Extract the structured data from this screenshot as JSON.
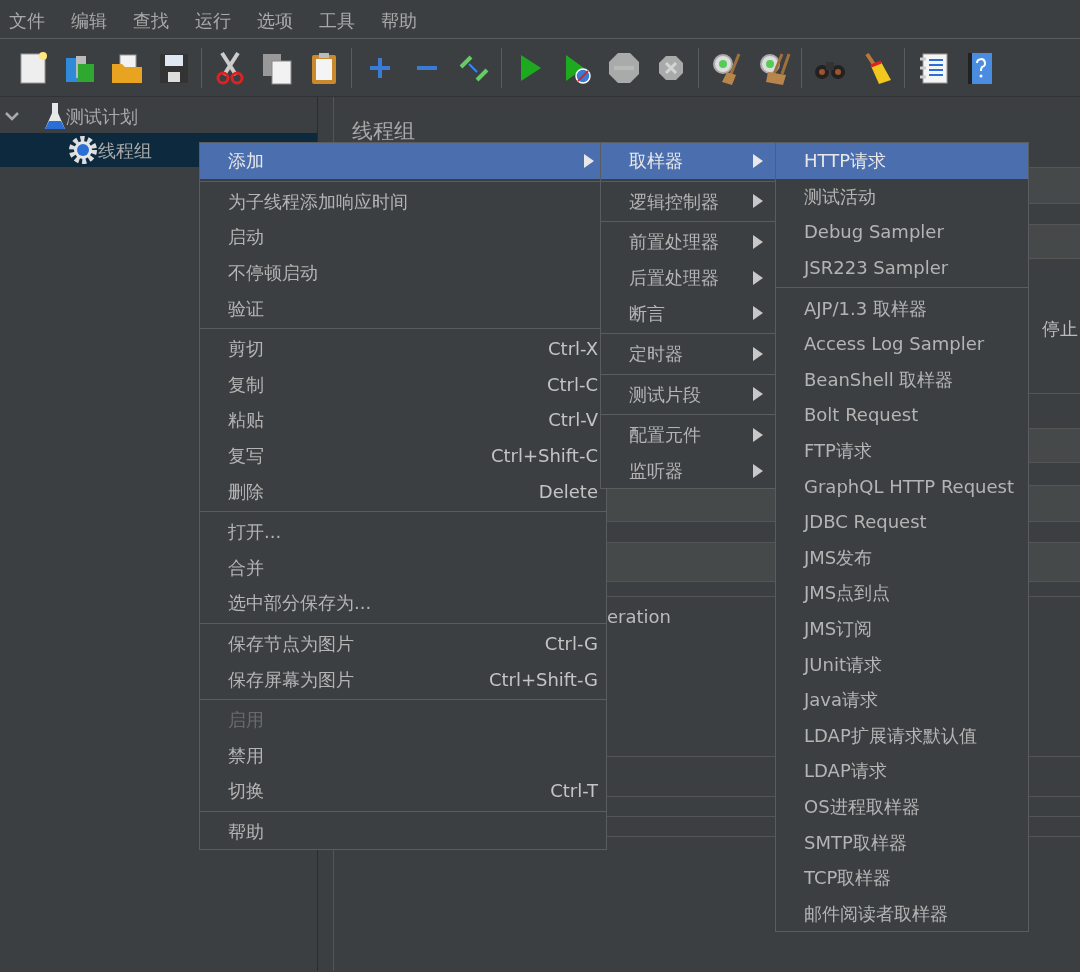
{
  "menu_bar": [
    "文件",
    "编辑",
    "查找",
    "运行",
    "选项",
    "工具",
    "帮助"
  ],
  "toolbar": [
    [
      {
        "kind": "new",
        "disabled": false
      },
      {
        "kind": "templates",
        "disabled": false
      },
      {
        "kind": "open",
        "disabled": false
      },
      {
        "kind": "save",
        "disabled": false
      }
    ],
    [
      {
        "kind": "cut",
        "disabled": false
      },
      {
        "kind": "copy",
        "disabled": false
      },
      {
        "kind": "paste",
        "disabled": false
      }
    ],
    [
      {
        "kind": "expand",
        "disabled": false
      },
      {
        "kind": "collapse",
        "disabled": false
      },
      {
        "kind": "toggle",
        "disabled": false
      }
    ],
    [
      {
        "kind": "start",
        "disabled": false
      },
      {
        "kind": "start-no-pauses",
        "disabled": false
      },
      {
        "kind": "stop",
        "disabled": true
      },
      {
        "kind": "shutdown",
        "disabled": true
      }
    ],
    [
      {
        "kind": "clear",
        "disabled": false
      },
      {
        "kind": "clear-all",
        "disabled": false
      }
    ],
    [
      {
        "kind": "search",
        "disabled": false
      },
      {
        "kind": "reset-search",
        "disabled": false
      }
    ],
    [
      {
        "kind": "function-helper",
        "disabled": false
      },
      {
        "kind": "help",
        "disabled": false
      }
    ]
  ],
  "tree": [
    {
      "label": "测试计划",
      "kind": "test-plan",
      "expanded": true,
      "selected": false,
      "children": [
        {
          "label": "线程组",
          "kind": "thread-group",
          "selected": true
        }
      ]
    }
  ],
  "panel": {
    "title": "线程组",
    "partial_texts": [
      "停止",
      "eration"
    ]
  },
  "context_menu": {
    "sections": [
      [
        {
          "label": "添加",
          "has_submenu": true,
          "selected": true,
          "disabled": false
        }
      ],
      [
        {
          "label": "为子线程添加响应时间",
          "has_submenu": false,
          "selected": false,
          "disabled": false
        },
        {
          "label": "启动",
          "has_submenu": false,
          "selected": false,
          "disabled": false
        },
        {
          "label": "不停顿启动",
          "has_submenu": false,
          "selected": false,
          "disabled": false
        },
        {
          "label": "验证",
          "has_submenu": false,
          "selected": false,
          "disabled": false
        }
      ],
      [
        {
          "label": "剪切",
          "shortcut": "Ctrl-X",
          "has_submenu": false,
          "selected": false,
          "disabled": false
        },
        {
          "label": "复制",
          "shortcut": "Ctrl-C",
          "has_submenu": false,
          "selected": false,
          "disabled": false
        },
        {
          "label": "粘贴",
          "shortcut": "Ctrl-V",
          "has_submenu": false,
          "selected": false,
          "disabled": false
        },
        {
          "label": "复写",
          "shortcut": "Ctrl+Shift-C",
          "has_submenu": false,
          "selected": false,
          "disabled": false
        },
        {
          "label": "删除",
          "shortcut": "Delete",
          "has_submenu": false,
          "selected": false,
          "disabled": false
        }
      ],
      [
        {
          "label": "打开...",
          "has_submenu": false,
          "selected": false,
          "disabled": false
        },
        {
          "label": "合并",
          "has_submenu": false,
          "selected": false,
          "disabled": false
        },
        {
          "label": "选中部分保存为...",
          "has_submenu": false,
          "selected": false,
          "disabled": false
        }
      ],
      [
        {
          "label": "保存节点为图片",
          "shortcut": "Ctrl-G",
          "has_submenu": false,
          "selected": false,
          "disabled": false
        },
        {
          "label": "保存屏幕为图片",
          "shortcut": "Ctrl+Shift-G",
          "has_submenu": false,
          "selected": false,
          "disabled": false
        }
      ],
      [
        {
          "label": "启用",
          "has_submenu": false,
          "selected": false,
          "disabled": true
        },
        {
          "label": "禁用",
          "has_submenu": false,
          "selected": false,
          "disabled": false
        },
        {
          "label": "切换",
          "shortcut": "Ctrl-T",
          "has_submenu": false,
          "selected": false,
          "disabled": false
        }
      ],
      [
        {
          "label": "帮助",
          "has_submenu": false,
          "selected": false,
          "disabled": false
        }
      ]
    ]
  },
  "add_submenu": {
    "sections": [
      [
        {
          "label": "取样器",
          "has_submenu": true,
          "selected": true
        }
      ],
      [
        {
          "label": "逻辑控制器",
          "has_submenu": true,
          "selected": false
        }
      ],
      [
        {
          "label": "前置处理器",
          "has_submenu": true,
          "selected": false
        },
        {
          "label": "后置处理器",
          "has_submenu": true,
          "selected": false
        },
        {
          "label": "断言",
          "has_submenu": true,
          "selected": false
        }
      ],
      [
        {
          "label": "定时器",
          "has_submenu": true,
          "selected": false
        }
      ],
      [
        {
          "label": "测试片段",
          "has_submenu": true,
          "selected": false
        }
      ],
      [
        {
          "label": "配置元件",
          "has_submenu": true,
          "selected": false
        },
        {
          "label": "监听器",
          "has_submenu": true,
          "selected": false
        }
      ]
    ]
  },
  "sampler_submenu": {
    "sections": [
      [
        {
          "label": "HTTP请求",
          "selected": true
        },
        {
          "label": "测试活动",
          "selected": false
        },
        {
          "label": "Debug Sampler",
          "selected": false
        },
        {
          "label": "JSR223 Sampler",
          "selected": false
        }
      ],
      [
        {
          "label": "AJP/1.3 取样器",
          "selected": false
        },
        {
          "label": "Access Log Sampler",
          "selected": false
        },
        {
          "label": "BeanShell 取样器",
          "selected": false
        },
        {
          "label": "Bolt Request",
          "selected": false
        },
        {
          "label": "FTP请求",
          "selected": false
        },
        {
          "label": "GraphQL HTTP Request",
          "selected": false
        },
        {
          "label": "JDBC Request",
          "selected": false
        },
        {
          "label": "JMS发布",
          "selected": false
        },
        {
          "label": "JMS点到点",
          "selected": false
        },
        {
          "label": "JMS订阅",
          "selected": false
        },
        {
          "label": "JUnit请求",
          "selected": false
        },
        {
          "label": "Java请求",
          "selected": false
        },
        {
          "label": "LDAP扩展请求默认值",
          "selected": false
        },
        {
          "label": "LDAP请求",
          "selected": false
        },
        {
          "label": "OS进程取样器",
          "selected": false
        },
        {
          "label": "SMTP取样器",
          "selected": false
        },
        {
          "label": "TCP取样器",
          "selected": false
        },
        {
          "label": "邮件阅读者取样器",
          "selected": false
        }
      ]
    ]
  }
}
